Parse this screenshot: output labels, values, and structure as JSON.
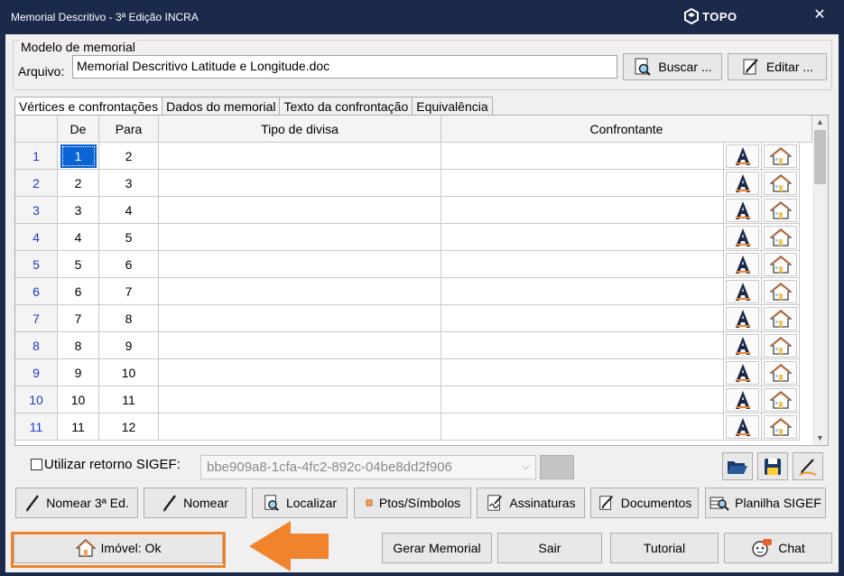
{
  "window": {
    "title": "Memorial Descritivo - 3ª Edição INCRA",
    "brand": "TOPO",
    "close_glyph": "✕"
  },
  "model": {
    "group_label": "Modelo de memorial",
    "file_label": "Arquivo:",
    "file_value": "Memorial Descritivo Latitude e Longitude.doc",
    "buscar_label": "Buscar ...",
    "editar_label": "Editar ..."
  },
  "tabs": [
    {
      "label": "Vértices e confrontações",
      "active": true
    },
    {
      "label": "Dados do memorial",
      "active": false
    },
    {
      "label": "Texto da confrontação",
      "active": false
    },
    {
      "label": "Equivalência",
      "active": false
    }
  ],
  "table": {
    "headers": [
      "",
      "De",
      "Para",
      "Tipo de divisa",
      "Confrontante"
    ],
    "rows": [
      {
        "n": "1",
        "de": "1",
        "para": "2",
        "tipo": "",
        "confrontante": ""
      },
      {
        "n": "2",
        "de": "2",
        "para": "3",
        "tipo": "",
        "confrontante": ""
      },
      {
        "n": "3",
        "de": "3",
        "para": "4",
        "tipo": "",
        "confrontante": ""
      },
      {
        "n": "4",
        "de": "4",
        "para": "5",
        "tipo": "",
        "confrontante": ""
      },
      {
        "n": "5",
        "de": "5",
        "para": "6",
        "tipo": "",
        "confrontante": ""
      },
      {
        "n": "6",
        "de": "6",
        "para": "7",
        "tipo": "",
        "confrontante": ""
      },
      {
        "n": "7",
        "de": "7",
        "para": "8",
        "tipo": "",
        "confrontante": ""
      },
      {
        "n": "8",
        "de": "8",
        "para": "9",
        "tipo": "",
        "confrontante": ""
      },
      {
        "n": "9",
        "de": "9",
        "para": "10",
        "tipo": "",
        "confrontante": ""
      },
      {
        "n": "10",
        "de": "10",
        "para": "11",
        "tipo": "",
        "confrontante": ""
      },
      {
        "n": "11",
        "de": "11",
        "para": "12",
        "tipo": "",
        "confrontante": ""
      }
    ],
    "selected_row": 0
  },
  "sigef": {
    "checkbox_label": "Utilizar retorno SIGEF:",
    "checked": false,
    "combo_value": "bbe909a8-1cfa-4fc2-892c-04be8dd2f906"
  },
  "toolbar": {
    "nomear3": "Nomear 3ª Ed.",
    "nomear": "Nomear",
    "localizar": "Localizar",
    "ptos": "Ptos/Símbolos",
    "assinaturas": "Assinaturas",
    "documentos": "Documentos",
    "planilha": "Planilha SIGEF"
  },
  "bottom": {
    "imovel": "Imóvel: Ok",
    "gerar": "Gerar Memorial",
    "sair": "Sair",
    "tutorial": "Tutorial",
    "chat": "Chat"
  },
  "colors": {
    "titlebar": "#1b2a4a",
    "highlight": "#f0832b",
    "selection": "#0a64d4",
    "rownum": "#1a3ccc"
  }
}
